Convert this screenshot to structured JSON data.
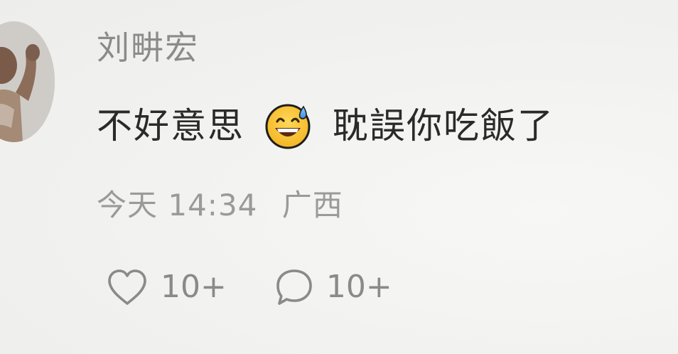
{
  "comment": {
    "username": "刘畊宏",
    "text_before_emoji": "不好意思",
    "emoji": "grinning-face-with-sweat-icon",
    "text_after_emoji": "耽誤你吃飯了",
    "time": "今天 14:34",
    "location": "广西",
    "like_count": "10+",
    "reply_count": "10+"
  },
  "colors": {
    "background": "#f3f3f1",
    "username": "#8b8b8b",
    "text": "#2a2a2a",
    "meta": "#9a9a9a",
    "icon": "#8a8a8a"
  }
}
